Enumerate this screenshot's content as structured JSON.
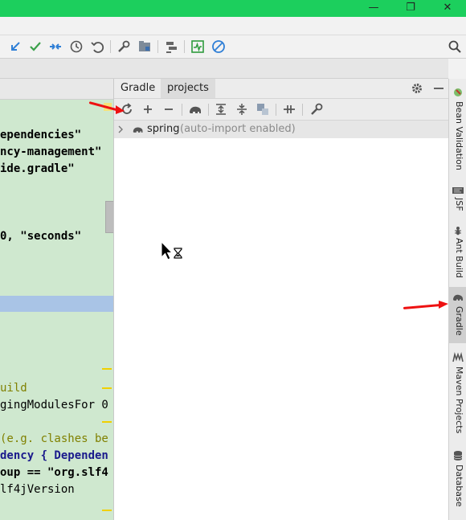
{
  "window": {
    "minimize_glyph": "—",
    "restore_glyph": "❐",
    "close_glyph": "✕"
  },
  "toolbar": {
    "icons": [
      "vcs-update-icon",
      "vcs-commit-icon",
      "compare-icon",
      "history-icon",
      "revert-icon",
      "settings-wrench-icon",
      "project-structure-icon",
      "sdk-manager-icon",
      "run-monitor-icon",
      "stop-icon",
      "search-icon"
    ]
  },
  "editor": {
    "lines": [
      "ependencies\"",
      "ncy-management\"",
      "ide.gradle\"",
      "0, \"seconds\"",
      "uild",
      "gingModulesFor 0",
      "(e.g. clashes be",
      "dency { Dependen",
      "oup == \"org.slf4",
      "lf4jVersion"
    ]
  },
  "gradle": {
    "tabs": [
      "Gradle",
      "projects"
    ],
    "active_tab": "projects",
    "toolbar_icons": [
      "refresh-icon",
      "add-icon",
      "remove-icon",
      "gradle-elephant-icon",
      "expand-all-icon",
      "collapse-all-icon",
      "group-modules-icon",
      "toggle-offline-icon",
      "build-settings-icon"
    ],
    "tree": {
      "project_name": "spring",
      "status": "(auto-import enabled)"
    },
    "header_icons": [
      "gear-icon",
      "hide-icon"
    ]
  },
  "sidebar": {
    "items": [
      {
        "label": "Bean Validation",
        "icon": "bean-validation-icon"
      },
      {
        "label": "JSF",
        "icon": "jsf-icon"
      },
      {
        "label": "Ant Build",
        "icon": "ant-icon"
      },
      {
        "label": "Gradle",
        "icon": "gradle-elephant-icon"
      },
      {
        "label": "Maven Projects",
        "icon": "maven-icon"
      },
      {
        "label": "Database",
        "icon": "database-icon"
      }
    ]
  },
  "colors": {
    "title_bar": "#1ccf5d",
    "editor_bg": "#cfe8cf",
    "selection": "#a9c4e6",
    "arrow": "#ee1111"
  }
}
